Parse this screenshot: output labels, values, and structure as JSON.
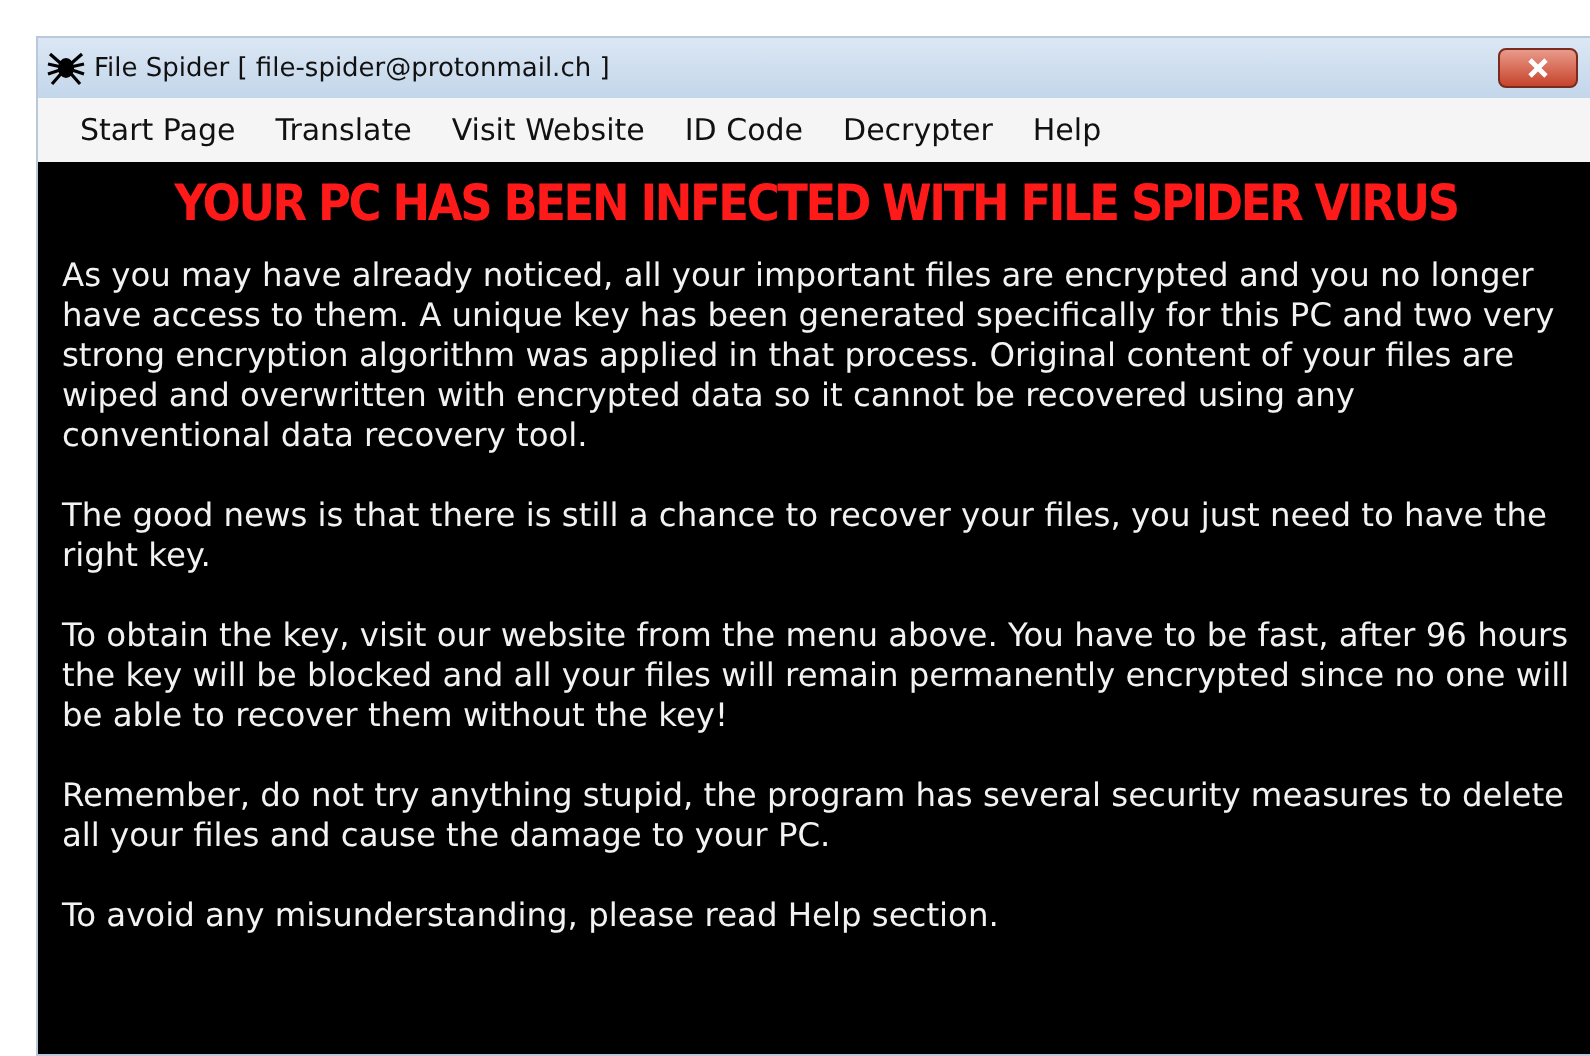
{
  "window": {
    "title": "File Spider [ file-spider@protonmail.ch ]"
  },
  "menu": [
    "Start Page",
    "Translate",
    "Visit Website",
    "ID Code",
    "Decrypter",
    "Help"
  ],
  "heading": "YOUR PC HAS BEEN INFECTED WITH FILE SPIDER VIRUS",
  "paragraphs": [
    "As you may have already noticed, all your important files are encrypted and you no longer have access to them. A unique key has been generated specifically for this PC and two very strong encryption algorithm was applied in that process. Original content of your files are wiped and overwritten with encrypted data so it cannot be recovered using any conventional data recovery tool.",
    "The good news is that there is still a chance to recover your files, you just need to have the right key.",
    "To obtain the key, visit our website from the menu above. You have to be fast, after 96 hours the key will be blocked and all your files will remain permanently encrypted since no one will be able to recover them without the key!",
    "Remember, do not try anything stupid, the program has several security measures to delete all your files and cause the damage to your PC.",
    "To avoid any misunderstanding, please read Help section."
  ]
}
